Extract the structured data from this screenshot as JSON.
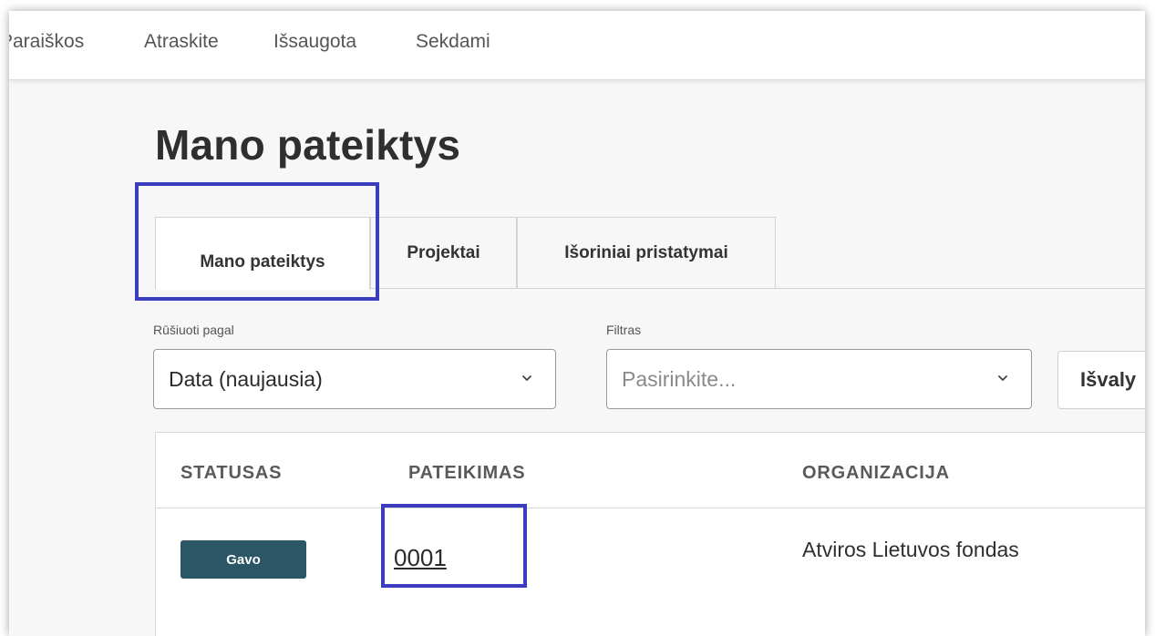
{
  "topnav": {
    "items": [
      {
        "label": "Paraiškos"
      },
      {
        "label": "Atraskite"
      },
      {
        "label": "Išsaugota"
      },
      {
        "label": "Sekdami"
      }
    ]
  },
  "page": {
    "title": "Mano pateiktys"
  },
  "tabs": [
    {
      "label": "Mano pateiktys",
      "active": true
    },
    {
      "label": "Projektai",
      "active": false
    },
    {
      "label": "Išoriniai pristatymai",
      "active": false
    }
  ],
  "sort": {
    "label": "Rūšiuoti pagal",
    "value": "Data (naujausia)"
  },
  "filter": {
    "label": "Filtras",
    "placeholder": "Pasirinkite..."
  },
  "clear_button": {
    "label": "Išvaly"
  },
  "table": {
    "columns": [
      "STATUSAS",
      "PATEIKIMAS",
      "ORGANIZACIJA"
    ],
    "rows": [
      {
        "status": "Gavo",
        "submission": "0001",
        "organization": "Atviros Lietuvos fondas"
      }
    ]
  },
  "colors": {
    "highlight": "#3a3dbd",
    "status_badge": "#2a5665"
  },
  "icons": {
    "dropdown": "chevron-down-icon"
  }
}
